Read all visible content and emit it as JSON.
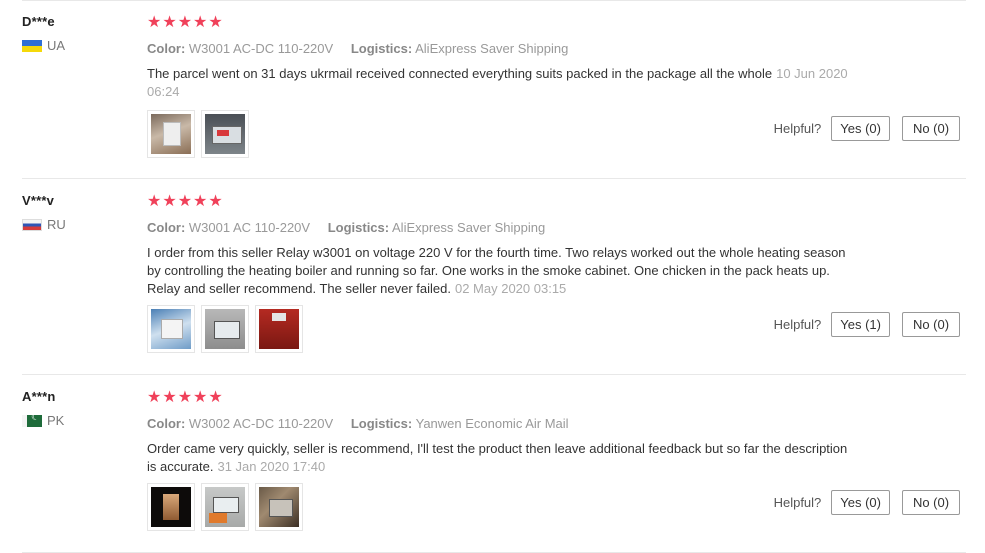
{
  "reviews": [
    {
      "user": "D***e",
      "country": "UA",
      "stars": "★★★★★",
      "color_label": "Color:",
      "color_value": "W3001 AC-DC 110-220V",
      "logistics_label": "Logistics:",
      "logistics_value": "AliExpress Saver Shipping",
      "text": "The parcel went on 31 days ukrmail received connected everything suits packed in the package all the whole",
      "date": "10 Jun 2020 06:24",
      "photos": [
        "relay-photo",
        "relay-display-photo"
      ],
      "helpful_label": "Helpful?",
      "yes_label": "Yes (0)",
      "no_label": "No (0)"
    },
    {
      "user": "V***v",
      "country": "RU",
      "stars": "★★★★★",
      "color_label": "Color:",
      "color_value": "W3001 AC 110-220V",
      "logistics_label": "Logistics:",
      "logistics_value": "AliExpress Saver Shipping",
      "text": "I order from this seller Relay w3001 on voltage 220 V for the fourth time. Two relays worked out the whole heating season by controlling the heating boiler and running so far. One works in the smoke cabinet. One chicken in the pack heats up. Relay and seller recommend. The seller never failed.",
      "date": "02 May 2020 03:15",
      "photos": [
        "packaged-relay-photo",
        "installed-relay-photo",
        "red-cabinet-photo"
      ],
      "helpful_label": "Helpful?",
      "yes_label": "Yes (1)",
      "no_label": "No (0)"
    },
    {
      "user": "A***n",
      "country": "PK",
      "stars": "★★★★★",
      "color_label": "Color:",
      "color_value": "W3002 AC-DC 110-220V",
      "logistics_label": "Logistics:",
      "logistics_value": "Yanwen Economic Air Mail",
      "text": "Order came very quickly, seller is recommend, I'll test the product then leave additional feedback but so far the description is accurate.",
      "date": "31 Jan 2020 17:40",
      "photos": [
        "probe-photo",
        "controller-photo",
        "wiring-photo"
      ],
      "helpful_label": "Helpful?",
      "yes_label": "Yes (0)",
      "no_label": "No (0)"
    }
  ],
  "colors": {
    "star": "#f0415a",
    "divider": "#e8e8e8",
    "muted_text": "#999999"
  }
}
